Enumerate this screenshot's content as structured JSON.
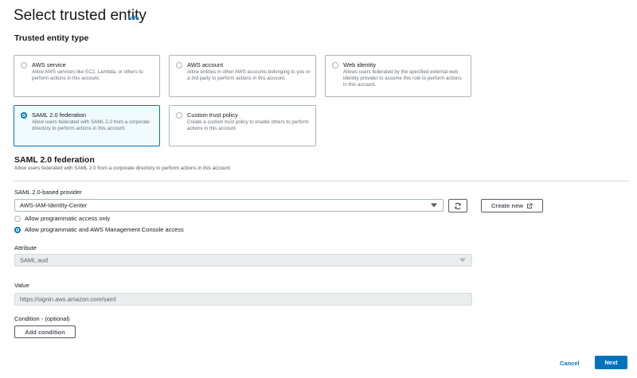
{
  "header": {
    "title": "Select trusted entity",
    "info": "Info"
  },
  "entity_type": {
    "heading": "Trusted entity type",
    "options": [
      {
        "title": "AWS service",
        "desc": "Allow AWS services like EC2, Lambda, or others to perform actions in this account.",
        "selected": false
      },
      {
        "title": "AWS account",
        "desc": "Allow entities in other AWS accounts belonging to you or a 3rd party to perform actions in this account.",
        "selected": false
      },
      {
        "title": "Web identity",
        "desc": "Allows users federated by the specified external web identity provider to assume this role to perform actions in this account.",
        "selected": false
      },
      {
        "title": "SAML 2.0 federation",
        "desc": "Allow users federated with SAML 2.0 from a corporate directory to perform actions in this account.",
        "selected": true
      },
      {
        "title": "Custom trust policy",
        "desc": "Create a custom trust policy to enable others to perform actions in this account.",
        "selected": false
      }
    ]
  },
  "saml": {
    "title": "SAML 2.0 federation",
    "desc": "Allow users federated with SAML 2.0 from a corporate directory to perform actions in this account.",
    "provider_label": "SAML 2.0-based provider",
    "provider_value": "AWS-IAM-Identity-Center",
    "refresh_icon": "refresh-icon",
    "create_new_label": "Create new",
    "external_icon": "external-link-icon",
    "access_options": [
      {
        "label": "Allow programmatic access only",
        "selected": false
      },
      {
        "label": "Allow programmatic and AWS Management Console access",
        "selected": true
      }
    ],
    "attribute_label": "Attribute",
    "attribute_value": "SAML:aud",
    "value_label": "Value",
    "value_value": "https://signin.aws.amazon.com/saml",
    "condition_label": "Condition - (optional)",
    "add_condition_label": "Add condition"
  },
  "footer": {
    "cancel_label": "Cancel",
    "next_label": "Next"
  },
  "colors": {
    "accent": "#0073bb",
    "border": "#aab7b8",
    "selected_bg": "#f1faff"
  }
}
